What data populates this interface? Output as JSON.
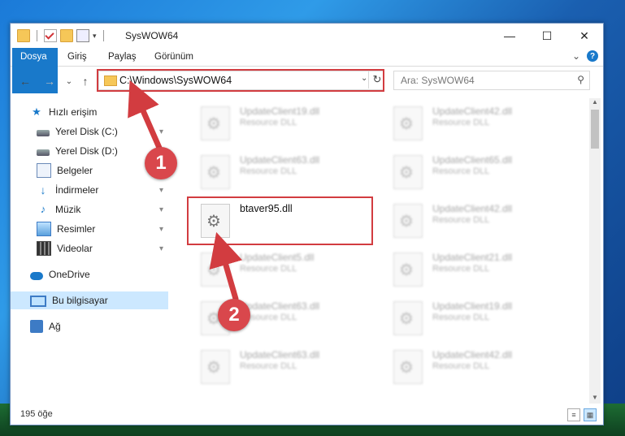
{
  "window": {
    "title": "SysWOW64",
    "minimize": "—",
    "maximize": "☐",
    "close": "✕"
  },
  "ribbon": {
    "tabs": [
      "Dosya",
      "Giriş",
      "Paylaş",
      "Görünüm"
    ],
    "expand": "⌄",
    "help": "?"
  },
  "nav": {
    "back": "←",
    "forward": "→",
    "recent": "⌄",
    "up": "↑"
  },
  "address": {
    "path": "C:\\Windows\\SysWOW64",
    "dropdown": "⌄",
    "refresh": "↻"
  },
  "search": {
    "placeholder": "Ara: SysWOW64",
    "icon": "⚲"
  },
  "sidebar": {
    "items": [
      {
        "label": "Hızlı erişim",
        "icon": "star-icon"
      },
      {
        "label": "Yerel Disk (C:)",
        "icon": "drive-icon",
        "pinned": true
      },
      {
        "label": "Yerel Disk (D:)",
        "icon": "drive-icon"
      },
      {
        "label": "Belgeler",
        "icon": "documents-icon"
      },
      {
        "label": "İndirmeler",
        "icon": "download-icon",
        "pinned": true
      },
      {
        "label": "Müzik",
        "icon": "music-icon",
        "pinned": true
      },
      {
        "label": "Resimler",
        "icon": "pictures-icon",
        "pinned": true
      },
      {
        "label": "Videolar",
        "icon": "videos-icon",
        "pinned": true
      },
      {
        "label": "OneDrive",
        "icon": "cloud-icon"
      },
      {
        "label": "Bu bilgisayar",
        "icon": "computer-icon",
        "selected": true
      },
      {
        "label": "Ağ",
        "icon": "network-icon"
      }
    ],
    "pin_glyph": "📌"
  },
  "files": {
    "left": [
      {
        "name": "UpdateClient19.dll",
        "desc": "Resource DLL"
      },
      {
        "name": "UpdateClient63.dll",
        "desc": "Resource DLL"
      },
      {
        "name": "btaver95.dll",
        "desc": ""
      },
      {
        "name": "UpdateClient5.dll",
        "desc": "Resource DLL"
      },
      {
        "name": "UpdateClient63.dll",
        "desc": "Resource DLL"
      },
      {
        "name": "UpdateClient63.dll",
        "desc": "Resource DLL"
      }
    ],
    "right": [
      {
        "name": "UpdateClient42.dll",
        "desc": "Resource DLL"
      },
      {
        "name": "UpdateClient65.dll",
        "desc": "Resource DLL"
      },
      {
        "name": "UpdateClient42.dll",
        "desc": "Resource DLL"
      },
      {
        "name": "UpdateClient21.dll",
        "desc": "Resource DLL"
      },
      {
        "name": "UpdateClient19.dll",
        "desc": "Resource DLL"
      },
      {
        "name": "UpdateClient42.dll",
        "desc": "Resource DLL"
      }
    ]
  },
  "status": {
    "count": "195 öğe"
  },
  "annotations": {
    "marker1": "1",
    "marker2": "2",
    "color": "#d23c40"
  }
}
